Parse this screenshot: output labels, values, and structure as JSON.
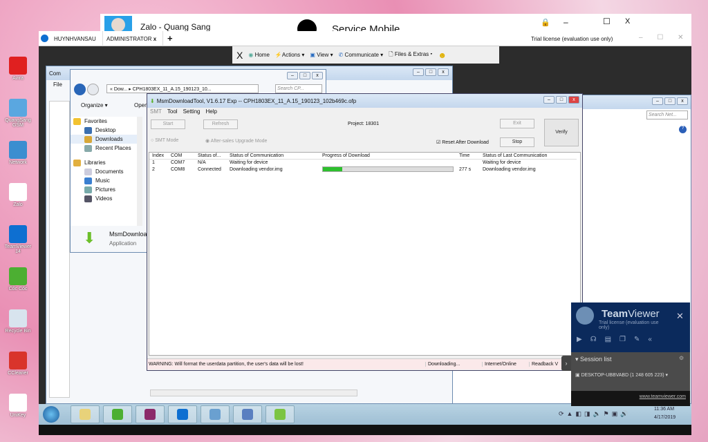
{
  "desktop_icons": [
    {
      "label": "Avira",
      "color": "#e02020"
    },
    {
      "label": "QuangSang GSM",
      "color": "#5aa7e0"
    },
    {
      "label": "Network",
      "color": "#3b8ed0"
    },
    {
      "label": "Zalo",
      "color": "#ffffff"
    },
    {
      "label": "TeamViewer 14",
      "color": "#0e6fd1"
    },
    {
      "label": "Cốc Cốc",
      "color": "#4caf32"
    },
    {
      "label": "Recycle Bin",
      "color": "#d8e4ee"
    },
    {
      "label": "CCleaner",
      "color": "#d9342b"
    },
    {
      "label": "UniKey",
      "color": "#ffffff"
    }
  ],
  "zalo": {
    "title": "Zalo - Quang Sang"
  },
  "service": {
    "title": "Service Mobile",
    "lock": "lock-icon",
    "minimize": "–",
    "maximize": "☐",
    "close": "X"
  },
  "teamviewer_window": {
    "tabs": [
      {
        "label": "HUYNHVANSAU"
      },
      {
        "label": "ADMINISTRATOR",
        "close": "x"
      }
    ],
    "add": "+",
    "license": "Trial license (evaluation use only)",
    "toolbar": {
      "close": "X",
      "home": "Home",
      "actions": "Actions",
      "view": "View",
      "communicate": "Communicate",
      "files": "Files & Extras"
    }
  },
  "computer_window": {
    "title": "Com",
    "menu_file": "File"
  },
  "explorer": {
    "breadcrumb_1": "Dow...",
    "breadcrumb_2": "CPH1803EX_11_A.15_190123_10...",
    "search_placeholder": "Search CP...",
    "organize": "Organize ▾",
    "open": "Open",
    "favorites": "Favorites",
    "items": [
      "Desktop",
      "Downloads",
      "Recent Places"
    ],
    "libraries": "Libraries",
    "lib_items": [
      "Documents",
      "Music",
      "Pictures",
      "Videos"
    ],
    "selected_name": "MsmDownloa",
    "selected_type": "Application"
  },
  "network_window": {
    "search_placeholder": "Search Net..."
  },
  "msm": {
    "title": "MsmDownloadTool, V1.6.17 Exp -- CPH1803EX_11_A.15_190123_102b469c.ofp",
    "menu": [
      "SMT",
      "Tool",
      "Setting",
      "Help"
    ],
    "start": "Start",
    "refresh": "Refresh",
    "project": "Project: 18301",
    "exit": "Exit",
    "verify": "Verify",
    "stop": "Stop",
    "smt_mode": "SMT Mode",
    "aftersales_mode": "After-sales Upgrade Mode",
    "reset_after_download": "Reset After Download",
    "reset_checked": true,
    "columns": [
      "Index",
      "COM",
      "Status of...",
      "Status of Communication",
      "Progress of Download",
      "Time",
      "Status of Last Communication"
    ],
    "rows": [
      {
        "index": "1",
        "com": "COM7",
        "status": "N/A",
        "comm": "Waiting for device",
        "progress": null,
        "time": "",
        "last": "Waiting for device"
      },
      {
        "index": "2",
        "com": "COM8",
        "status": "Connected",
        "comm": "Downloading vendor.img",
        "progress": 15,
        "time": "277 s",
        "last": "Downloading vendor.img"
      }
    ],
    "status_warning": "WARNING: Will format the userdata partition, the user's data will be lost!",
    "status_2": "Downloading...",
    "status_3": "Internet/Online",
    "status_4": "Readback V"
  },
  "tv_panel": {
    "brand_bold": "Team",
    "brand_light": "Viewer",
    "license": "Trial license (evaluation use only)",
    "session_list": "Session list",
    "session": "DESKTOP-UBBVABD (1 248 605 223)",
    "link": "www.teamviewer.com"
  },
  "taskbar": {
    "time": "11:36 AM",
    "date": "4/17/2019"
  }
}
